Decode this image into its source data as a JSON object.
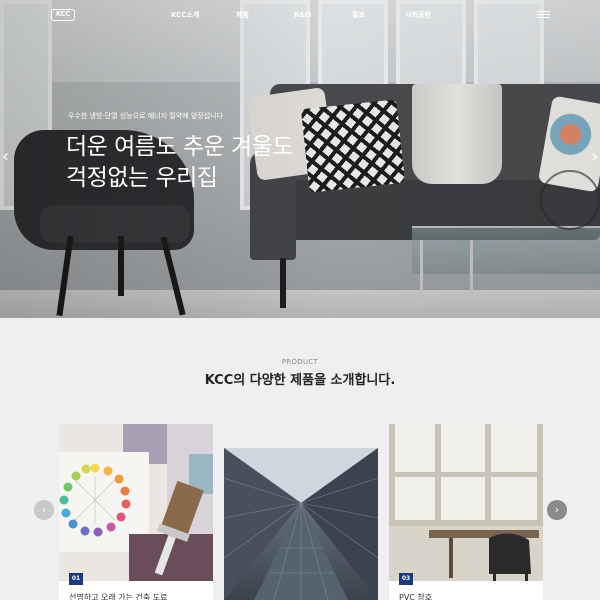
{
  "nav": {
    "logo": "KCC",
    "menu": [
      "KCC소개",
      "제품",
      "R&D",
      "홍보",
      "사회공헌"
    ]
  },
  "hero": {
    "subtitle": "우수한 냉방·단열 성능으로 에너지 절약에 앞장섭니다",
    "title_line1": "더운 여름도 추운 겨울도",
    "title_line2": "걱정없는 우리집",
    "prev_icon": "‹",
    "next_icon": "›"
  },
  "products": {
    "label": "PRODUCT",
    "title": "KCC의 다양한 제품을 소개합니다.",
    "cards": [
      {
        "number": "01",
        "text": "선명하고 오래 가는 건축 도료"
      },
      {
        "number": "",
        "text": ""
      },
      {
        "number": "03",
        "text": "PVC 창호"
      }
    ],
    "prev_icon": "‹",
    "next_icon": "›"
  },
  "colors": {
    "accent": "#1b3a7e",
    "background": "#efefef"
  }
}
